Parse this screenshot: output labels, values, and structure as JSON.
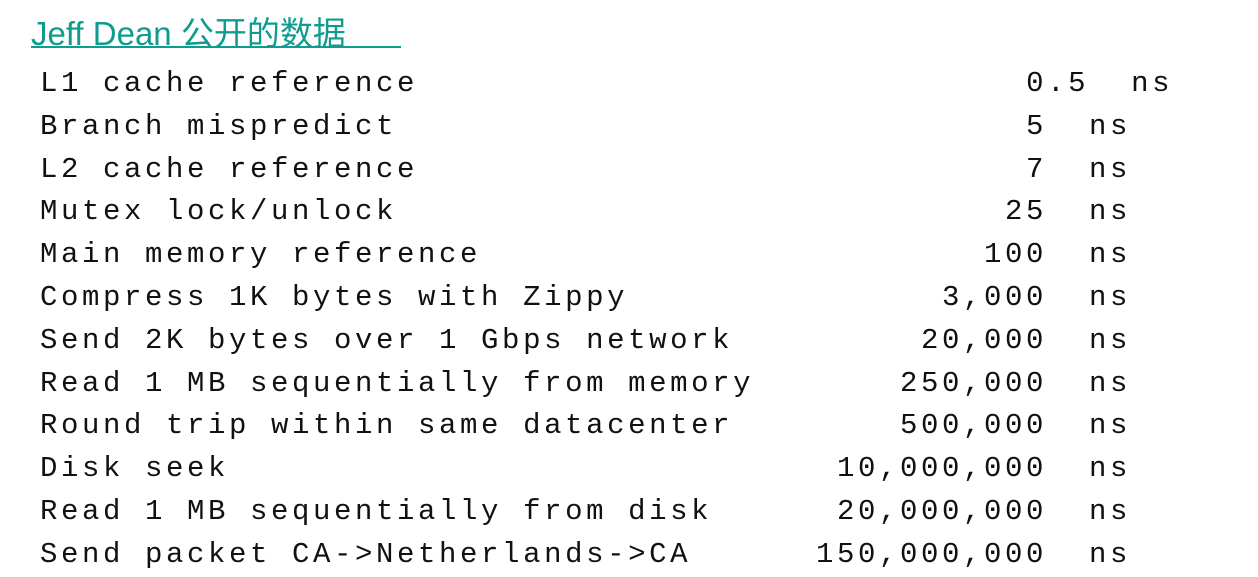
{
  "page": {
    "background_color": "#ffffff",
    "text_color": "#111111"
  },
  "title": {
    "text": "Jeff Dean 公开的数据",
    "color": "#0f9c8e",
    "underlined": true
  },
  "units": {
    "ns": "ns"
  },
  "table": {
    "columns": [
      "operation",
      "latency",
      "unit"
    ],
    "rows": [
      {
        "operation": "L1 cache reference",
        "latency": "0.5",
        "unit": "ns"
      },
      {
        "operation": "Branch mispredict",
        "latency": "5",
        "unit": "ns"
      },
      {
        "operation": "L2 cache reference",
        "latency": "7",
        "unit": "ns"
      },
      {
        "operation": "Mutex lock/unlock",
        "latency": "25",
        "unit": "ns"
      },
      {
        "operation": "Main memory reference",
        "latency": "100",
        "unit": "ns"
      },
      {
        "operation": "Compress 1K bytes with Zippy",
        "latency": "3,000",
        "unit": "ns"
      },
      {
        "operation": "Send 2K bytes over 1 Gbps network",
        "latency": "20,000",
        "unit": "ns"
      },
      {
        "operation": "Read 1 MB sequentially from memory",
        "latency": "250,000",
        "unit": "ns"
      },
      {
        "operation": "Round trip within same datacenter",
        "latency": "500,000",
        "unit": "ns"
      },
      {
        "operation": "Disk seek",
        "latency": "10,000,000",
        "unit": "ns"
      },
      {
        "operation": "Read 1 MB sequentially from disk",
        "latency": "20,000,000",
        "unit": "ns"
      },
      {
        "operation": "Send packet CA->Netherlands->CA",
        "latency": "150,000,000",
        "unit": "ns"
      }
    ]
  }
}
